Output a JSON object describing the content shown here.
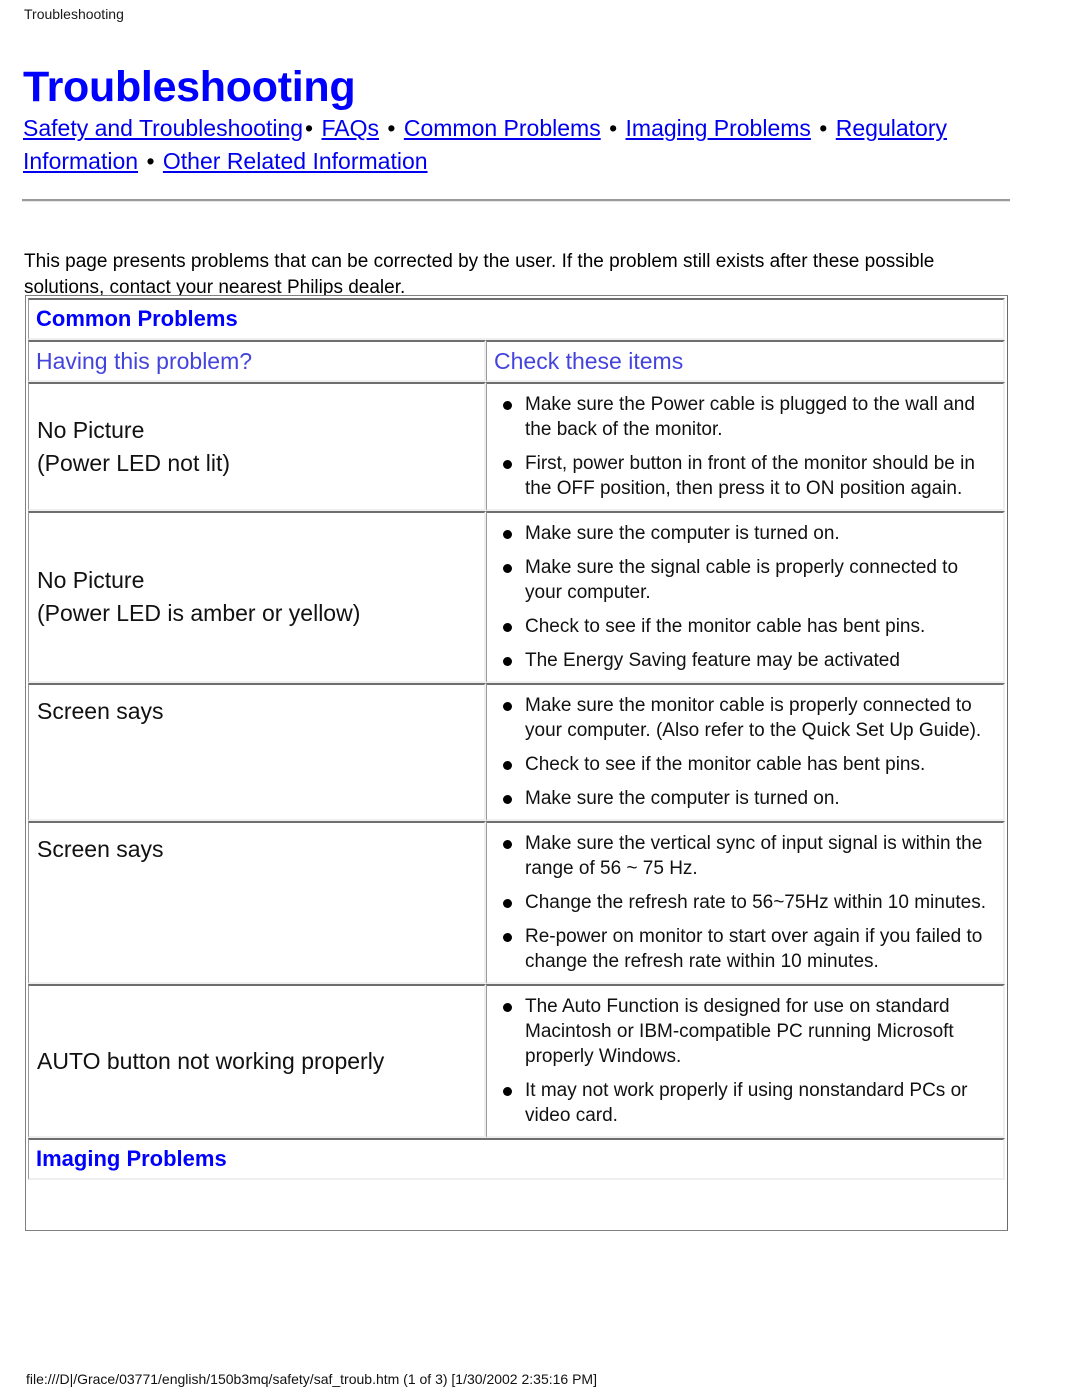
{
  "running_head": "Troubleshooting",
  "page_title": "Troubleshooting",
  "nav": {
    "separator": "•",
    "links": [
      "Safety and Troubleshooting",
      "FAQs",
      "Common Problems",
      "Imaging Problems",
      "Regulatory Information",
      "Other Related Information"
    ]
  },
  "intro": "This page presents problems that can be corrected by the user. If the problem still exists after these possible solutions, contact your nearest Philips dealer.",
  "table": {
    "section_common": "Common Problems",
    "section_imaging": "Imaging Problems",
    "headers": {
      "left": "Having this problem?",
      "right": "Check these items"
    },
    "rows": [
      {
        "problem_line1": "No Picture",
        "problem_line2": "(Power LED not lit)",
        "align": "middle",
        "items": [
          "Make sure the Power cable is plugged to the wall and the back of the monitor.",
          "First, power button in front of the monitor should be in the OFF position, then press it to ON position again."
        ]
      },
      {
        "problem_line1": "No Picture",
        "problem_line2": "(Power LED is amber or yellow)",
        "align": "middle",
        "items": [
          "Make sure the computer is turned on.",
          "Make sure the signal cable is properly connected to your computer.",
          "Check to see if the monitor cable has bent pins.",
          "The Energy Saving feature may be activated"
        ]
      },
      {
        "problem_line1": "Screen says",
        "problem_line2": "",
        "align": "top",
        "items": [
          "Make sure the monitor cable is properly connected to your computer. (Also refer to the Quick Set Up Guide).",
          "Check to see if the monitor cable has bent pins.",
          "Make sure the computer is turned on."
        ]
      },
      {
        "problem_line1": "Screen says",
        "problem_line2": "",
        "align": "top",
        "items": [
          "Make sure the vertical sync of input signal is within the range of 56 ~ 75 Hz.",
          "Change the refresh rate to 56~75Hz within 10 minutes.",
          "Re-power on monitor to start over again if you failed to change the refresh rate within 10 minutes."
        ]
      },
      {
        "problem_line1": "AUTO button not working properly",
        "problem_line2": "",
        "align": "middle",
        "items": [
          "The Auto Function is designed for use on standard Macintosh or IBM-compatible PC running Microsoft properly Windows.",
          "It may not work properly if using nonstandard PCs or video card."
        ]
      }
    ]
  },
  "footer_path": "file:///D|/Grace/03771/english/150b3mq/safety/saf_troub.htm (1 of 3) [1/30/2002 2:35:16 PM]",
  "colors": {
    "title_blue": "#0000ff",
    "link_blue": "#0000ee",
    "header_blue": "#4444dd",
    "rule_gray": "#9a9a9a"
  }
}
